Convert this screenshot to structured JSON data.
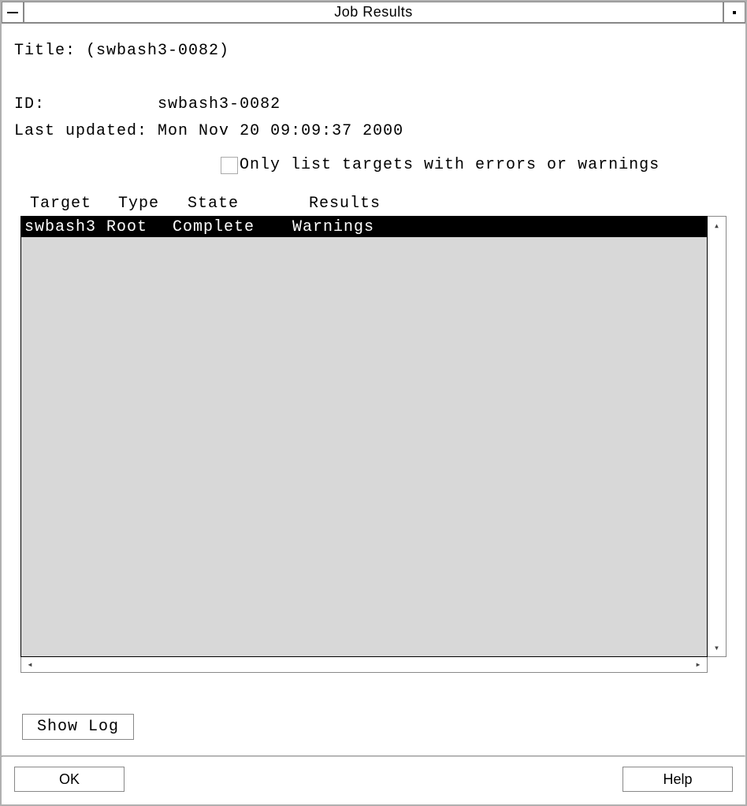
{
  "window": {
    "title": "Job Results"
  },
  "info": {
    "title_label": "Title:",
    "title_value": "(swbash3-0082)",
    "id_label": "ID:",
    "id_value": "swbash3-0082",
    "updated_label": "Last updated:",
    "updated_value": "Mon Nov 20 09:09:37 2000"
  },
  "filter": {
    "label": "Only list targets with errors or warnings",
    "checked": false
  },
  "columns": {
    "target": "Target",
    "type": "Type",
    "state": "State",
    "results": "Results"
  },
  "rows": [
    {
      "target": "swbash3",
      "type": "Root",
      "state": "Complete",
      "results": "Warnings",
      "selected": true
    }
  ],
  "buttons": {
    "show_log": "Show Log",
    "ok": "OK",
    "help": "Help"
  }
}
